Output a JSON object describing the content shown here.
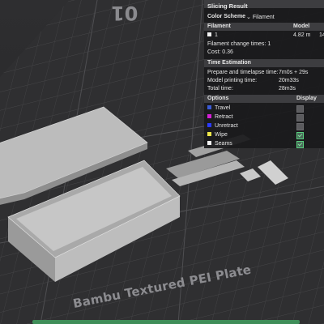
{
  "plate": {
    "label": "Bambu Textured PEI Plate",
    "number": "01"
  },
  "panel": {
    "title": "Slicing Result",
    "color_scheme_label": "Color Scheme",
    "color_scheme_value": "Filament",
    "filament_header": "Filament",
    "model_header": "Model",
    "filament_row": {
      "index": "1",
      "model_length": "4.82 m",
      "extra": "14"
    },
    "change_times_label": "Filament change times:",
    "change_times_value": "1",
    "cost_label": "Cost:",
    "cost_value": "0.36",
    "time_header": "Time Estimation",
    "prepare_label": "Prepare and timelapse time:",
    "prepare_value": "7m0s + 29s",
    "model_time_label": "Model printing time:",
    "model_time_value": "20m33s",
    "total_label": "Total time:",
    "total_value": "28m3s",
    "options_header": "Options",
    "display_header": "Display",
    "options": [
      {
        "label": "Travel",
        "color": "#3b5bd6",
        "checked": false
      },
      {
        "label": "Retract",
        "color": "#d61fd6",
        "checked": false
      },
      {
        "label": "Unretract",
        "color": "#2b3bff",
        "checked": false
      },
      {
        "label": "Wipe",
        "color": "#f0e84a",
        "checked": true
      },
      {
        "label": "Seams",
        "color": "#f2f2f2",
        "checked": true
      }
    ]
  }
}
